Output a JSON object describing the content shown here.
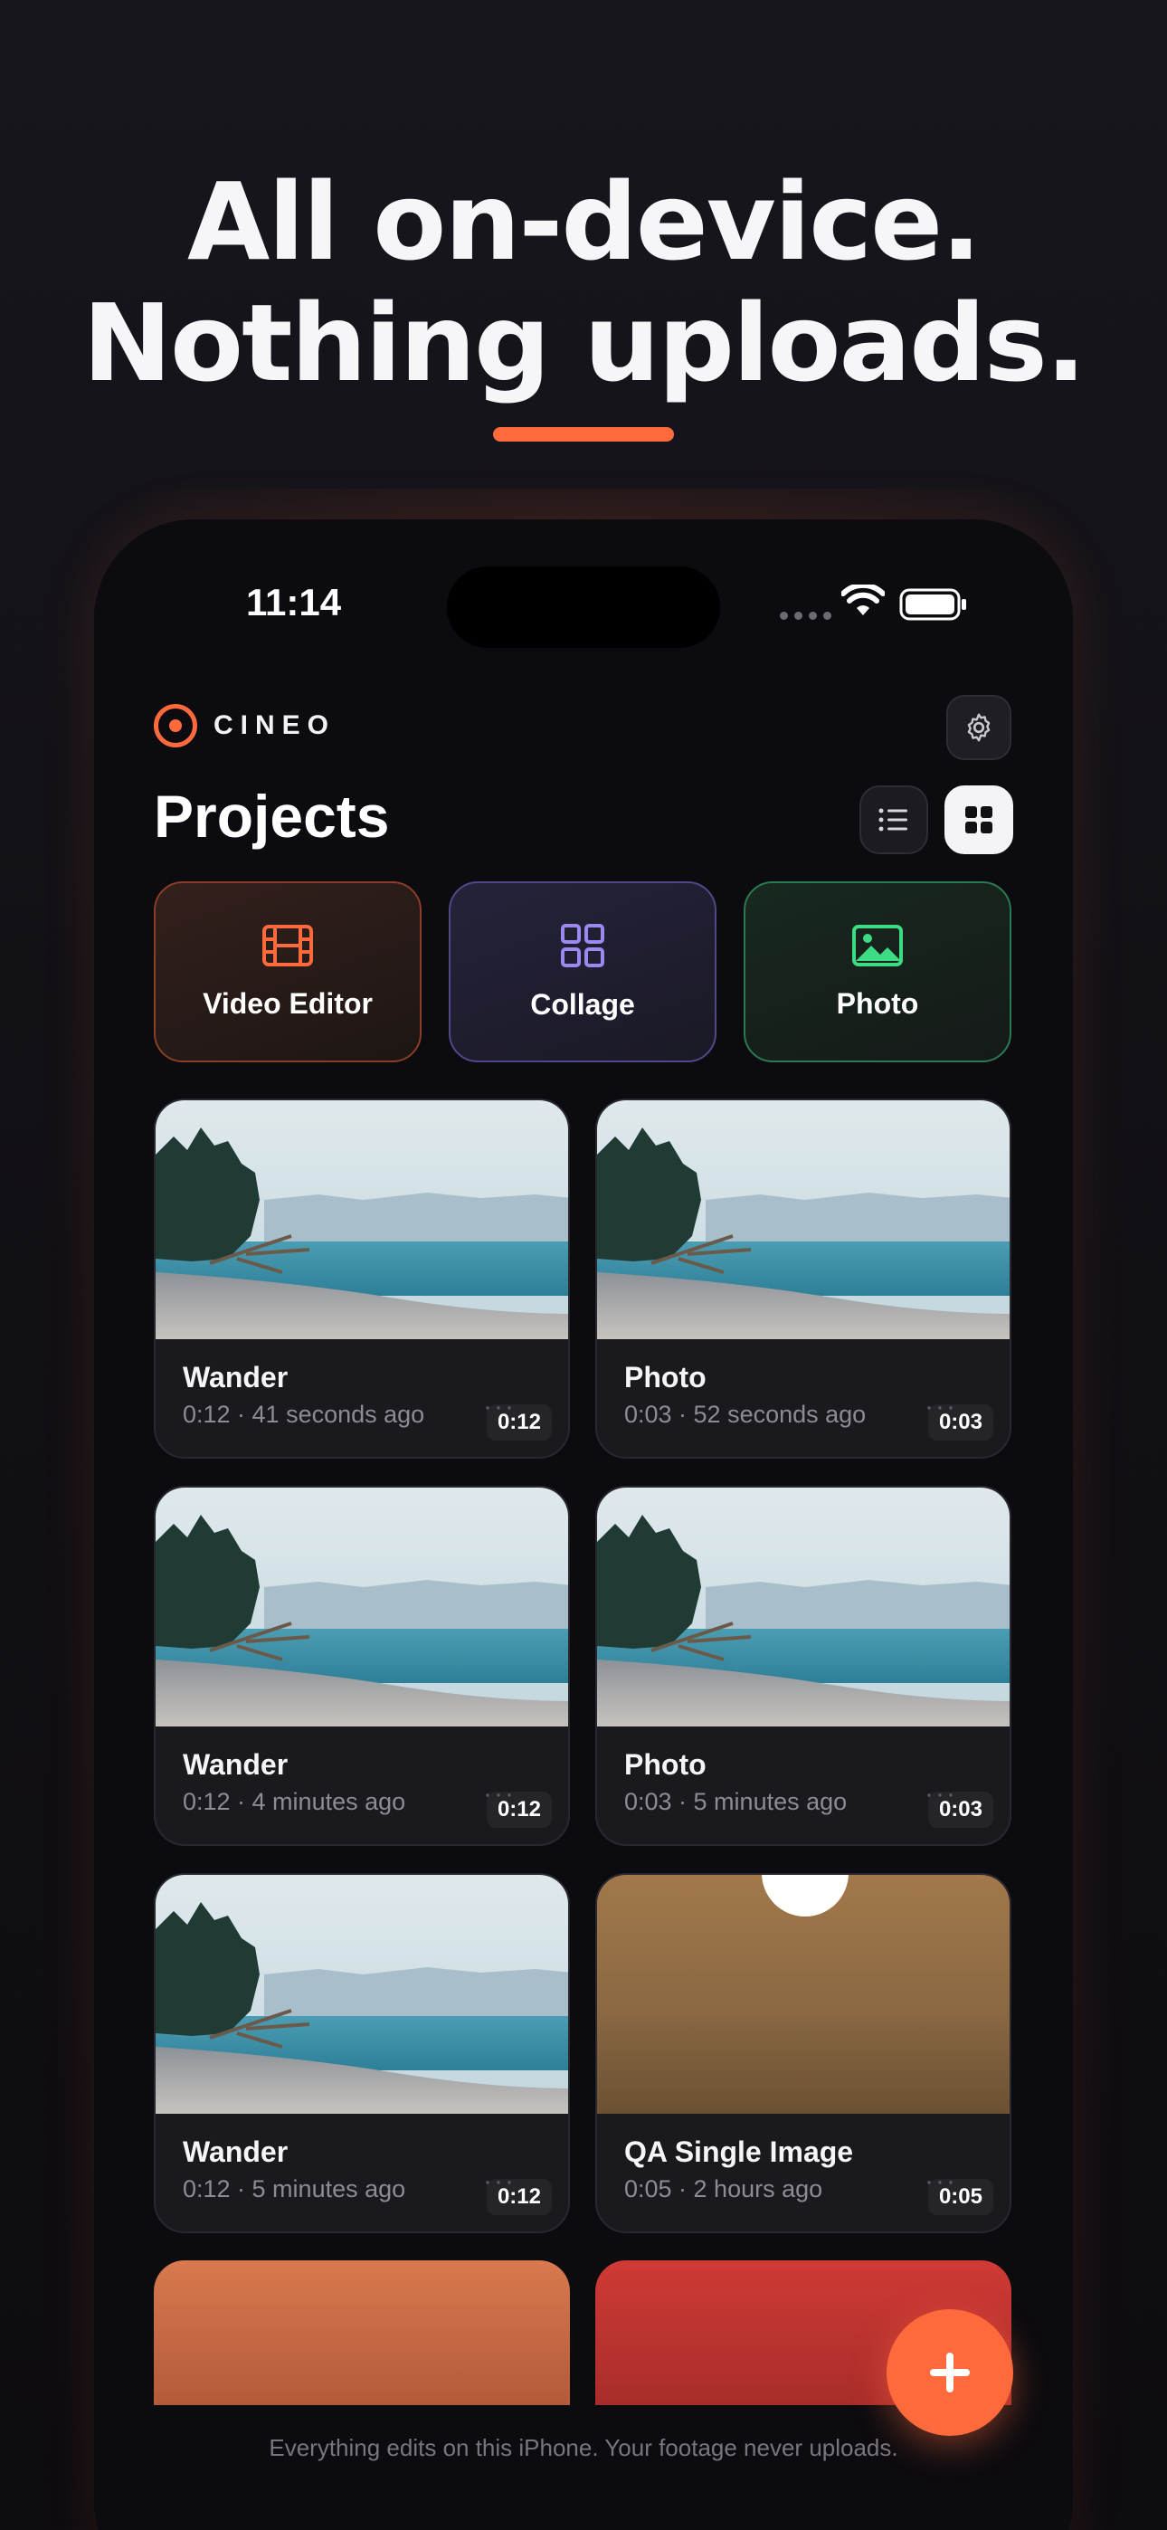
{
  "headline": {
    "line1": "All on-device.",
    "line2": "Nothing uploads."
  },
  "accent_color": "#ff6a3d",
  "status_bar": {
    "time": "11:14",
    "icons": [
      "signal-dots-icon",
      "wifi-icon",
      "battery-icon"
    ]
  },
  "app": {
    "brand": "CINEO",
    "title": "Projects",
    "view_modes": [
      "list",
      "grid"
    ],
    "active_view": "grid"
  },
  "quick_actions": [
    {
      "label": "Video Editor",
      "icon": "film-icon",
      "color": "#ff6a3d"
    },
    {
      "label": "Collage",
      "icon": "grid-icon",
      "color": "#9b88f0"
    },
    {
      "label": "Photo",
      "icon": "image-icon",
      "color": "#3ddc84"
    }
  ],
  "projects": [
    {
      "title": "Wander",
      "duration": "0:12",
      "meta": "0:12 · 41 seconds ago",
      "thumb": "beach"
    },
    {
      "title": "Photo",
      "duration": "0:03",
      "meta": "0:03 · 52 seconds ago",
      "thumb": "beach"
    },
    {
      "title": "Wander",
      "duration": "0:12",
      "meta": "0:12 · 4 minutes ago",
      "thumb": "beach"
    },
    {
      "title": "Photo",
      "duration": "0:03",
      "meta": "0:03 · 5 minutes ago",
      "thumb": "beach"
    },
    {
      "title": "Wander",
      "duration": "0:12",
      "meta": "0:12 · 5 minutes ago",
      "thumb": "beach"
    },
    {
      "title": "QA Single Image",
      "duration": "0:05",
      "meta": "0:05 · 2 hours ago",
      "thumb": "gold"
    }
  ],
  "more_glyph": "···",
  "footer_note": "Everything edits on this iPhone. Your footage never uploads."
}
